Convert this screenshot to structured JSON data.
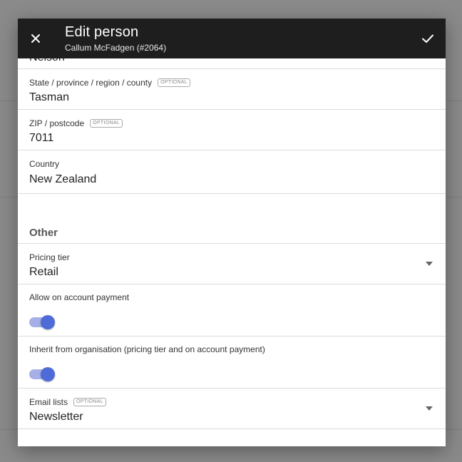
{
  "header": {
    "title": "Edit person",
    "subtitle": "Callum McFadgen (#2064)"
  },
  "optional_badge": "OPTIONAL",
  "fields": {
    "city": {
      "value": "Nelson"
    },
    "state": {
      "label": "State / province / region / county",
      "value": "Tasman",
      "optional": true
    },
    "zip": {
      "label": "ZIP / postcode",
      "value": "7011",
      "optional": true
    },
    "country": {
      "label": "Country",
      "value": "New Zealand"
    }
  },
  "other": {
    "section_title": "Other",
    "pricing_tier": {
      "label": "Pricing tier",
      "value": "Retail"
    },
    "allow_on_account": {
      "label": "Allow on account payment",
      "enabled": true
    },
    "inherit": {
      "label": "Inherit from organisation (pricing tier and on account payment)",
      "enabled": true
    },
    "email_lists": {
      "label": "Email lists",
      "value": "Newsletter",
      "optional": true
    }
  },
  "colors": {
    "header_bg": "#1e1e1e",
    "toggle_on": "#4f6bd8",
    "toggle_track": "#a4b0e6"
  },
  "icons": {
    "close": "close-icon",
    "save": "check-icon",
    "dropdown": "chevron-down-icon"
  }
}
